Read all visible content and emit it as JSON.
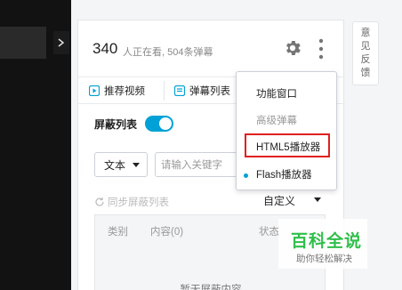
{
  "header": {
    "viewer_count": "340",
    "viewer_text": "人正在看, 504条弹幕"
  },
  "tabs": [
    {
      "label": "推荐视频",
      "icon": "play-icon"
    },
    {
      "label": "弹幕列表",
      "icon": "list-icon"
    }
  ],
  "shield": {
    "label": "屏蔽列表",
    "enabled": true
  },
  "filter": {
    "type_value": "文本",
    "keyword_placeholder": "请输入关键字"
  },
  "sync": {
    "label": "同步屏蔽列表",
    "custom_label": "自定义"
  },
  "table": {
    "columns": [
      "类别",
      "内容(0)",
      "状态"
    ],
    "empty_text": "暂无屏蔽内容"
  },
  "feedback": {
    "chars": [
      "意",
      "见",
      "反",
      "馈"
    ]
  },
  "menu": {
    "items": [
      {
        "label": "功能窗口",
        "state": "normal"
      },
      {
        "label": "高级弹幕",
        "state": "disabled"
      },
      {
        "label": "HTML5播放器",
        "state": "highlighted"
      },
      {
        "label": "Flash播放器",
        "state": "selected"
      }
    ]
  },
  "watermark": {
    "title": "百科全说",
    "subtitle": "助你轻松解决"
  },
  "colors": {
    "accent": "#00a1d6",
    "highlight_box": "#e02020",
    "watermark_green": "#2fbf4a"
  }
}
